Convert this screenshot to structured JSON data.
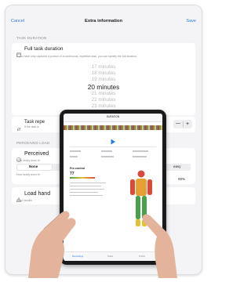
{
  "nav": {
    "cancel": "Cancel",
    "title": "Extra information",
    "save": "Save"
  },
  "task_duration": {
    "section": "TASK DURATION",
    "title": "Full task duration",
    "subtitle": "If you have only captured a portion of a continuous, repetitive task, you can specify the full duration.",
    "picker_options": [
      "17 minutes",
      "18 minutes",
      "19 minutes",
      "20 minutes",
      "21 minutes",
      "22 minutes",
      "23 minutes"
    ],
    "selected": "20 minutes"
  },
  "task_repeat": {
    "label": "Task repe",
    "sub": "If the task is",
    "minus": "—",
    "plus": "+"
  },
  "perceived_load": {
    "section": "PERCEIVED LOAD",
    "title": "Perceived",
    "sub1": "How heavy does th",
    "option_none": "None",
    "option_heavy": "eavy",
    "sub2": "How heavy does th",
    "pct": "00%"
  },
  "load_handling": {
    "title": "Load hand",
    "sub": "Load handlin"
  },
  "tablet": {
    "title": "DURATION",
    "section_label": "Pre-control",
    "score": "77",
    "rating_label": "risk",
    "tabs": [
      "Recordings",
      "Tasks",
      "Profile"
    ]
  },
  "colors": {
    "accent": "#2e7bd6",
    "tablet_accent": "#2e7bd6",
    "risk_green": "#4aa04a",
    "risk_yellow": "#e6c033",
    "risk_red": "#d84a3a"
  }
}
